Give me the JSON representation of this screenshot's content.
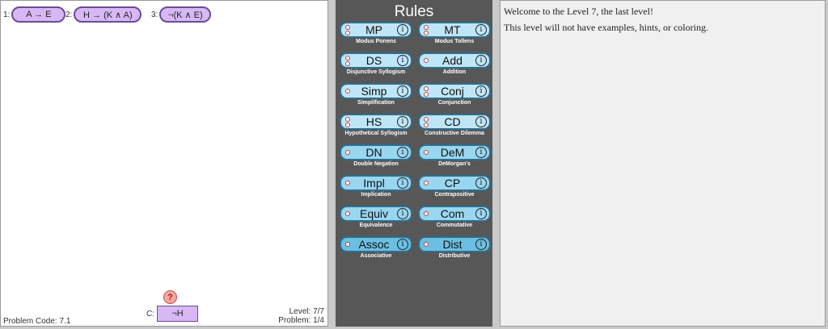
{
  "premises": [
    {
      "num": "1:",
      "text": "A → E"
    },
    {
      "num": "2:",
      "text": "H → (K ∧ A)"
    },
    {
      "num": "3:",
      "text": "¬(K ∧ E)"
    }
  ],
  "conclusion": {
    "label": "C:",
    "text": "¬H"
  },
  "hint": {
    "glyph": "?"
  },
  "problem_code": "Problem Code: 7.1",
  "level": "Level: 7/7",
  "problem": "Problem: 1/4",
  "rules": {
    "title": "Rules",
    "items": [
      {
        "name": "MP",
        "desc": "Modus Ponens",
        "inputs": 2
      },
      {
        "name": "MT",
        "desc": "Modus Tollens",
        "inputs": 2
      },
      {
        "name": "DS",
        "desc": "Disjunctive Syllogism",
        "inputs": 2
      },
      {
        "name": "Add",
        "desc": "Addition",
        "inputs": 1
      },
      {
        "name": "Simp",
        "desc": "Simplification",
        "inputs": 1
      },
      {
        "name": "Conj",
        "desc": "Conjunction",
        "inputs": 2
      },
      {
        "name": "HS",
        "desc": "Hypothetical Syllogism",
        "inputs": 2
      },
      {
        "name": "CD",
        "desc": "Constructive Dilemma",
        "inputs": 2
      },
      {
        "name": "DN",
        "desc": "Double Negation",
        "inputs": 1
      },
      {
        "name": "DeM",
        "desc": "DeMorgan's",
        "inputs": 1
      },
      {
        "name": "Impl",
        "desc": "Implication",
        "inputs": 1
      },
      {
        "name": "CP",
        "desc": "Contrapositive",
        "inputs": 1
      },
      {
        "name": "Equiv",
        "desc": "Equivalence",
        "inputs": 1
      },
      {
        "name": "Com",
        "desc": "Commutative",
        "inputs": 1
      },
      {
        "name": "Assoc",
        "desc": "Associative",
        "inputs": 1
      },
      {
        "name": "Dist",
        "desc": "Distributive",
        "inputs": 1
      }
    ]
  },
  "messages": [
    "Welcome to the Level 7, the last level!",
    "This level will not have examples, hints, or coloring."
  ],
  "colors": {
    "premise_fill": "#d7b8f5",
    "premise_border": "#6a4c93",
    "rules_panel": "#575757"
  }
}
